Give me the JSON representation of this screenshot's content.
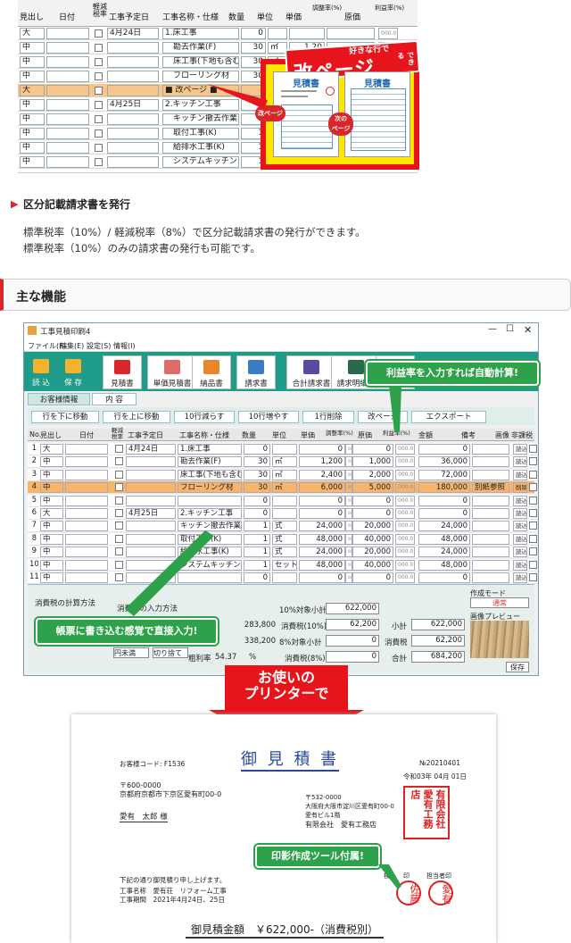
{
  "top_table": {
    "headers": [
      "見出し",
      "日付",
      "軽減税率",
      "工事予定日",
      "工事名称・仕様",
      "数量",
      "単位",
      "単価",
      "調整率(%)",
      "原価",
      "利益率(%)"
    ],
    "rows": [
      {
        "midashi": "大",
        "date": "",
        "yotei": "4月24日",
        "name": "1.床工事",
        "qty": "0",
        "unit": "",
        "price": "",
        "cost": ""
      },
      {
        "midashi": "中",
        "date": "",
        "yotei": "",
        "name": "　勘去作業(F)",
        "qty": "30",
        "unit": "㎡",
        "price": "1,20",
        "cost": ""
      },
      {
        "midashi": "中",
        "date": "",
        "yotei": "",
        "name": "　床工事(下地も含む",
        "qty": "30",
        "unit": "㎡",
        "price": "",
        "cost": ""
      },
      {
        "midashi": "中",
        "date": "",
        "yotei": "",
        "name": "　フローリング材",
        "qty": "30",
        "unit": "㎡",
        "price": "",
        "cost": ""
      },
      {
        "midashi": "大",
        "date": "",
        "yotei": "",
        "name": "■ 改ページ ■",
        "qty": "",
        "unit": "",
        "price": "",
        "cost": ""
      },
      {
        "midashi": "中",
        "date": "",
        "yotei": "4月25日",
        "name": "2.キッチン工事",
        "qty": "",
        "unit": "",
        "price": "",
        "cost": ""
      },
      {
        "midashi": "中",
        "date": "",
        "yotei": "",
        "name": "　キッチン撤去作業",
        "qty": "1",
        "unit": "式",
        "price": "",
        "cost": ""
      },
      {
        "midashi": "中",
        "date": "",
        "yotei": "",
        "name": "　取付工事(K)",
        "qty": "1",
        "unit": "式",
        "price": "",
        "cost": ""
      },
      {
        "midashi": "中",
        "date": "",
        "yotei": "",
        "name": "　給排水工事(K)",
        "qty": "1",
        "unit": "式",
        "price": "",
        "cost": ""
      },
      {
        "midashi": "中",
        "date": "",
        "yotei": "",
        "name": "　システムキッチン",
        "qty": "1",
        "unit": "セ",
        "price": "",
        "cost": ""
      }
    ],
    "rate_small": "000.0"
  },
  "callout": {
    "banner_top": "好きな行で",
    "banner_main": "改ページ",
    "banner_side": "できる",
    "doc_title": "見積書",
    "label_kaipage": "改ページ",
    "label_next": "次の\nページ"
  },
  "feature": {
    "title": "区分記載請求書を発行",
    "line1": "標準税率（10%）/ 軽減税率（8%）で区分記載請求書の発行ができます。",
    "line2": "標準税率（10%）のみの請求書の発行も可能です。"
  },
  "section": {
    "title": "主な機能"
  },
  "app": {
    "title": "工事見積印刷4",
    "menu": [
      "ファイル(F)",
      "編集(E)",
      "設定(S)",
      "情報(I)"
    ],
    "toolbar": [
      "読 込",
      "保 存",
      "見積書",
      "単価見積書",
      "納品書",
      "請求書",
      "合計請求書",
      "請求明細書",
      "発注書"
    ],
    "tabs": [
      "お客様情報",
      "内 容"
    ],
    "actions": [
      "行を下に移動",
      "行を上に移動",
      "10行減らす",
      "10行増やす",
      "1行削除",
      "改ページ",
      "エクスポート"
    ],
    "grid_headers": [
      "No.",
      "見出し",
      "日付",
      "軽減税率",
      "工事予定日",
      "工事名称・仕様",
      "数量",
      "単位",
      "単価",
      "調整率(%)",
      "原価",
      "利益率(%)",
      "金額",
      "備考",
      "画像",
      "非課税"
    ],
    "rows": [
      {
        "no": "1",
        "midashi": "大",
        "yotei": "4月24日",
        "name": "1.床工事",
        "qty": "0",
        "unit": "",
        "price": "0",
        "cost": "0",
        "amount": "0",
        "note": "",
        "img": "読込"
      },
      {
        "no": "2",
        "midashi": "中",
        "yotei": "",
        "name": "勘去作業(F)",
        "qty": "30",
        "unit": "㎡",
        "price": "1,200",
        "cost": "1,000",
        "amount": "36,000",
        "note": "",
        "img": "読込"
      },
      {
        "no": "3",
        "midashi": "中",
        "yotei": "",
        "name": "床工事(下地も含む",
        "qty": "30",
        "unit": "㎡",
        "price": "2,400",
        "cost": "2,000",
        "amount": "72,000",
        "note": "",
        "img": "読込"
      },
      {
        "no": "4",
        "midashi": "中",
        "yotei": "",
        "name": "フローリング材",
        "qty": "30",
        "unit": "㎡",
        "price": "6,000",
        "cost": "5,000",
        "amount": "180,000",
        "note": "別紙参照",
        "img": "削除"
      },
      {
        "no": "5",
        "midashi": "中",
        "yotei": "",
        "name": "",
        "qty": "0",
        "unit": "",
        "price": "0",
        "cost": "0",
        "amount": "0",
        "note": "",
        "img": "読込"
      },
      {
        "no": "6",
        "midashi": "大",
        "yotei": "4月25日",
        "name": "2.キッチン工事",
        "qty": "0",
        "unit": "",
        "price": "0",
        "cost": "0",
        "amount": "0",
        "note": "",
        "img": "読込"
      },
      {
        "no": "7",
        "midashi": "中",
        "yotei": "",
        "name": "キッチン撤去作業",
        "qty": "1",
        "unit": "式",
        "price": "24,000",
        "cost": "20,000",
        "amount": "24,000",
        "note": "",
        "img": "読込"
      },
      {
        "no": "8",
        "midashi": "中",
        "yotei": "",
        "name": "取付工事(K)",
        "qty": "1",
        "unit": "式",
        "price": "48,000",
        "cost": "40,000",
        "amount": "48,000",
        "note": "",
        "img": "読込"
      },
      {
        "no": "9",
        "midashi": "中",
        "yotei": "",
        "name": "給排水工事(K)",
        "qty": "1",
        "unit": "式",
        "price": "24,000",
        "cost": "20,000",
        "amount": "24,000",
        "note": "",
        "img": "読込"
      },
      {
        "no": "10",
        "midashi": "中",
        "yotei": "",
        "name": "システムキッチン",
        "qty": "1",
        "unit": "セット",
        "price": "48,000",
        "cost": "40,000",
        "amount": "48,000",
        "note": "",
        "img": "読込"
      },
      {
        "no": "11",
        "midashi": "中",
        "yotei": "",
        "name": "",
        "qty": "0",
        "unit": "",
        "price": "0",
        "cost": "0",
        "amount": "0",
        "note": "",
        "img": "読込"
      }
    ],
    "rate_small": "000.0",
    "bottom": {
      "tax_calc": "消費税の計算方法",
      "tax_input": "消費税の入力方法",
      "tax_input_val": "円未満",
      "round_val": "切り捨て",
      "v1": "283,800",
      "v2": "338,200",
      "arari_label": "粗利率",
      "arari_val": "54.37",
      "pct": "%",
      "l10_sub": "10%対象小計",
      "l10_sub_val": "622,000",
      "l10_tax": "消費税(10%)",
      "l10_tax_val": "62,200",
      "l8_sub": "8%対象小計",
      "l8_sub_val": "0",
      "l8_tax": "消費税(8%)",
      "l8_tax_val": "0",
      "subtotal": "小計",
      "subtotal_val": "622,000",
      "tax": "消費税",
      "tax_val": "62,200",
      "total": "合計",
      "total_val": "684,200",
      "mode_label": "作成モード",
      "mode_val": "通常",
      "preview_label": "画像プレビュー",
      "save": "保存"
    }
  },
  "bubbles": {
    "profit": "利益率を入力すれば自動計算!",
    "direct": "帳票に書き込む感覚で直接入力!",
    "stamp": "印影作成ツール付属!"
  },
  "arrow": {
    "line1": "お使いの",
    "line2": "プリンターで"
  },
  "quote": {
    "title": "御 見 積 書",
    "customer_code": "お客様コード: F1536",
    "no": "№20210401",
    "date": "令和03年 04月 01日",
    "zip": "〒600-0000",
    "addr": "京都府京都市下京区愛有町00-0",
    "name": "愛有　太郎 様",
    "co_zip": "〒532-0000",
    "co_addr": "大阪府大阪市淀川区愛有町00-0",
    "co_bldg": "愛有ビル1階",
    "co_name": "有限会社　愛有工務店",
    "intro": "下記の通り御見積り申し上げます。",
    "work_name": "工事名称　愛有荘　リフォーム工事",
    "work_period": "工事期間　2021年4月24日、25日",
    "stamp_labels": [
      "検",
      "印",
      "担当者印"
    ],
    "seal_co": "有限会社愛有工務店",
    "seal1": "佐藤",
    "seal2": "愛有",
    "total": "御見積金額　￥622,000-（消費税別）"
  }
}
